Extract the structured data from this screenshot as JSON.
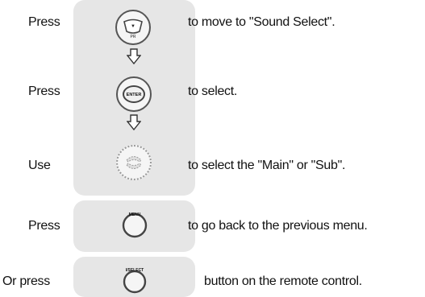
{
  "steps": [
    {
      "verb": "Press",
      "text": "to move to \"Sound Select\".",
      "button": "down-nav-button",
      "icon_text": "▼",
      "icon_subtext": "PR"
    },
    {
      "verb": "Press",
      "text": "to select.",
      "button": "enter-button",
      "icon_text": "ENTER"
    },
    {
      "verb": "Use",
      "text": "to select the \"Main\" or \"Sub\".",
      "button": "up-down-nav-button"
    },
    {
      "verb": "Press",
      "text": "to go back to the previous menu.",
      "button": "menu-button",
      "icon_text": "MENU"
    },
    {
      "verb": "Or press",
      "text": "button on the remote control.",
      "button": "i-select-button",
      "icon_text": "I/SELECT"
    }
  ],
  "colors": {
    "panel": "#e6e6e6",
    "button_border": "#555555",
    "text": "#111111"
  }
}
